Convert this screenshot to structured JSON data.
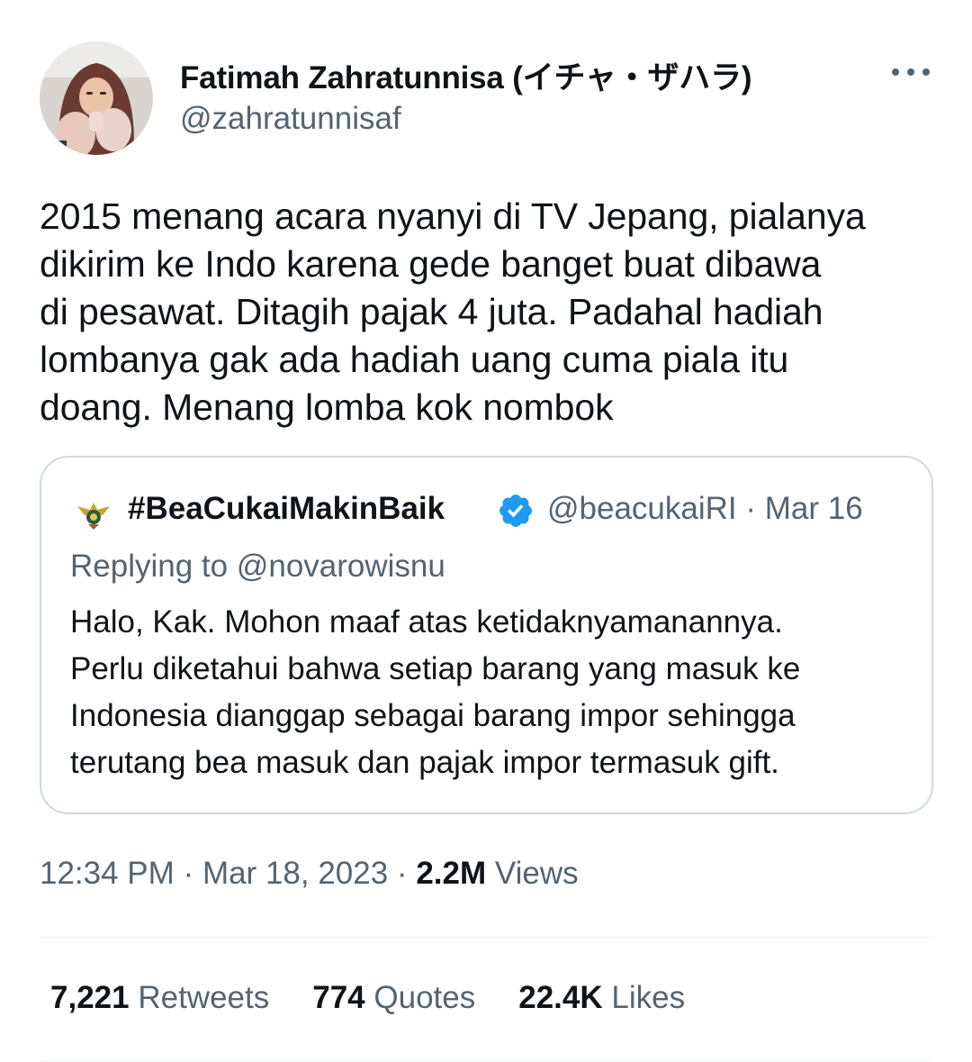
{
  "author": {
    "display_name": "Fatimah Zahratunnisa (イチャ・ザハラ)",
    "handle": "@zahratunnisaf",
    "avatar_icon": "user-avatar-photo"
  },
  "more_icon": "more-horizontal-icon",
  "tweet": {
    "text": "2015 menang acara nyanyi di TV Jepang, pialanya\ndikirim ke Indo karena gede banget buat dibawa\ndi pesawat. Ditagih pajak 4 juta. Padahal hadiah\nlombanya gak ada hadiah uang cuma piala itu\ndoang. Menang lomba kok nombok"
  },
  "quote": {
    "logo_icon": "bea-cukai-logo-icon",
    "name": "#BeaCukaiMakinBaik",
    "verified_icon": "verified-badge-icon",
    "handle": "@beacukaiRI",
    "separator": "·",
    "date": "Mar 16",
    "replying_prefix": "Replying to ",
    "replying_to": "@novarowisnu",
    "text": "Halo, Kak. Mohon maaf atas ketidaknyamanannya.\nPerlu diketahui bahwa setiap barang yang masuk ke\nIndonesia dianggap sebagai barang impor sehingga\nterutang bea masuk dan pajak impor termasuk gift."
  },
  "meta": {
    "time": "12:34 PM",
    "separator": "·",
    "date": "Mar 18, 2023",
    "views_count": "2.2M",
    "views_label": "Views"
  },
  "stats": {
    "retweets_count": "7,221",
    "retweets_label": "Retweets",
    "quotes_count": "774",
    "quotes_label": "Quotes",
    "likes_count": "22.4K",
    "likes_label": "Likes"
  },
  "colors": {
    "text_primary": "#0f1419",
    "text_secondary": "#536471",
    "border": "#cfd9de",
    "verified": "#1d9bf0"
  }
}
